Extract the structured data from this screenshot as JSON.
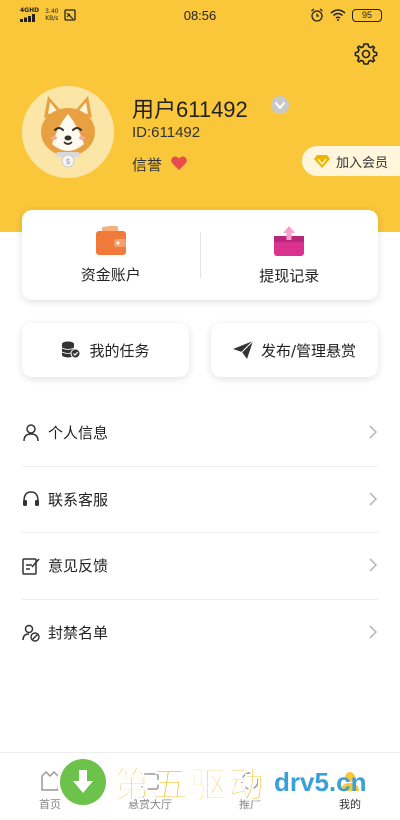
{
  "status_bar": {
    "network": "4GHD",
    "speed": "3.40",
    "speed_unit": "KB/s",
    "time": "08:56",
    "battery": "95"
  },
  "profile": {
    "username": "用户611492",
    "user_id": "ID:611492",
    "credit_label": "信誉",
    "vip_label": "加入会员"
  },
  "wallet": {
    "account_label": "资金账户",
    "withdraw_label": "提现记录"
  },
  "actions": {
    "my_task_label": "我的任务",
    "publish_label": "发布/管理悬赏"
  },
  "menu": {
    "items": [
      {
        "label": "个人信息",
        "icon": "person-icon"
      },
      {
        "label": "联系客服",
        "icon": "headset-icon"
      },
      {
        "label": "意见反馈",
        "icon": "feedback-icon"
      },
      {
        "label": "封禁名单",
        "icon": "blocklist-icon"
      }
    ]
  },
  "tab_bar": {
    "tabs": [
      {
        "label": "首页",
        "icon": "home-icon"
      },
      {
        "label": "悬赏大厅",
        "icon": "hall-icon"
      },
      {
        "label": "推广",
        "icon": "promote-icon"
      },
      {
        "label": "我的",
        "icon": "me-icon"
      }
    ],
    "active_index": 3
  },
  "watermark": {
    "text": "第五驱动",
    "domain": "drv5.cn"
  },
  "colors": {
    "brand_yellow": "#fac63a",
    "wallet_orange": "#f07a3a",
    "withdraw_pink": "#d9338f",
    "heart_red": "#e84b4b",
    "vip_gold": "#f0b400"
  }
}
